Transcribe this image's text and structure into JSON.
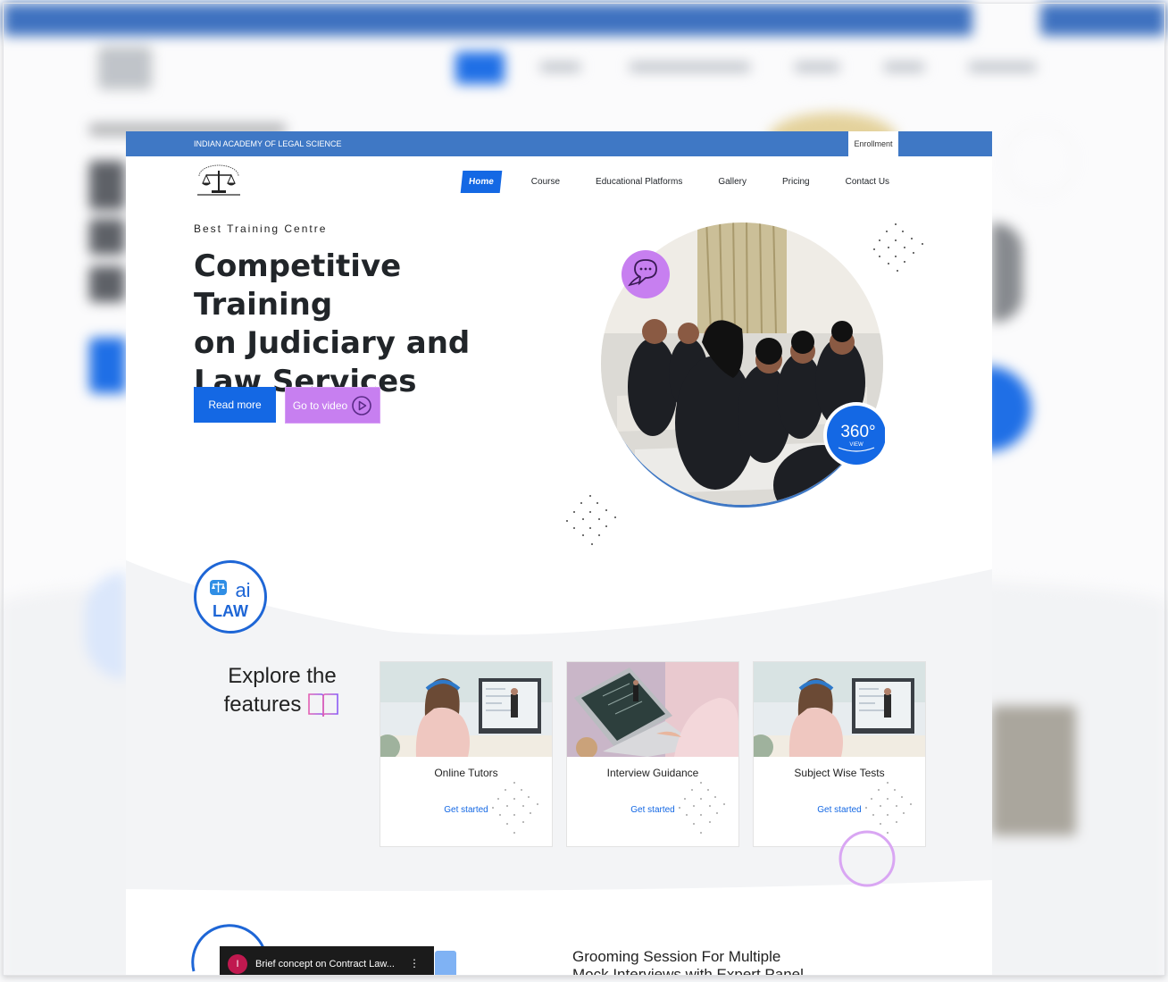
{
  "topbar": {
    "title": "INDIAN ACADEMY OF LEGAL SCIENCE",
    "enroll": "Enrollment"
  },
  "nav": {
    "items": [
      {
        "label": "Home",
        "active": true
      },
      {
        "label": "Course"
      },
      {
        "label": "Educational Platforms"
      },
      {
        "label": "Gallery"
      },
      {
        "label": "Pricing"
      },
      {
        "label": "Contact Us"
      }
    ]
  },
  "hero": {
    "kicker": "Best Training Centre",
    "title_line1": "Competitive Training",
    "title_line2": "on Judiciary and",
    "title_line3": "Law Services",
    "read_more": "Read more",
    "go_to_video": "Go to video",
    "badge_360": "360°",
    "badge_view": "VIEW"
  },
  "ailaw": {
    "ai": "ai",
    "law": "LAW"
  },
  "features": {
    "heading_line1": "Explore the",
    "heading_line2": "features",
    "cards": [
      {
        "title": "Online Tutors",
        "link": "Get started"
      },
      {
        "title": "Interview Guidance",
        "link": "Get started"
      },
      {
        "title": "Subject Wise Tests",
        "link": "Get started"
      }
    ]
  },
  "video": {
    "avatar_letter": "I",
    "title": "Brief concept on Contract Law..."
  },
  "grooming": {
    "line1": "Grooming Session For Multiple",
    "line2": "Mock Interviews with Expert Panel"
  },
  "colors": {
    "brand_blue": "#1468e4",
    "topbar": "#3f78c5",
    "accent_purple": "#c77ff0"
  }
}
